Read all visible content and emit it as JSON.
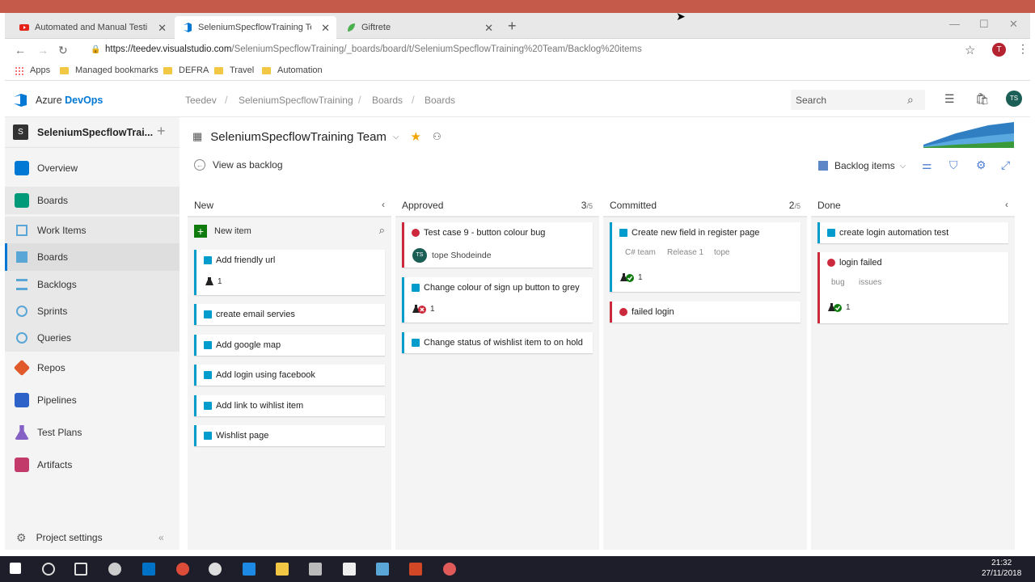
{
  "browser": {
    "tabs": [
      {
        "label": "Automated and Manual Testing",
        "icon": "youtube-icon",
        "color": "#e62117"
      },
      {
        "label": "SeleniumSpecflowTraining Team",
        "icon": "azure-devops-icon",
        "color": "#0078d4"
      },
      {
        "label": "Giftrete",
        "icon": "leaf-icon",
        "color": "#4caf50"
      }
    ],
    "url_host": "https://teedev.visualstudio.com",
    "url_path": "/SeleniumSpecflowTraining/_boards/board/t/SeleniumSpecflowTraining%20Team/Backlog%20items",
    "profile_initial": "T",
    "bookmarks": [
      "Apps",
      "Managed bookmarks",
      "DEFRA",
      "Travel",
      "Automation"
    ]
  },
  "header": {
    "brand_prefix": "Azure ",
    "brand": "DevOps",
    "breadcrumb": [
      "Teedev",
      "SeleniumSpecflowTraining",
      "Boards",
      "Boards"
    ],
    "search_placeholder": "Search",
    "avatar": "TS"
  },
  "sidebar": {
    "project_initial": "S",
    "project_name": "SeleniumSpecflowTrai...",
    "items": [
      {
        "label": "Overview",
        "color": "#0078d4"
      },
      {
        "label": "Boards",
        "color": "#009a78"
      },
      {
        "label": "Work Items",
        "color": "#5aa6d6"
      },
      {
        "label": "Boards",
        "color": "#5aa6d6"
      },
      {
        "label": "Backlogs",
        "color": "#5aa6d6"
      },
      {
        "label": "Sprints",
        "color": "#5aa6d6"
      },
      {
        "label": "Queries",
        "color": "#5aa6d6"
      },
      {
        "label": "Repos",
        "color": "#e05a2b"
      },
      {
        "label": "Pipelines",
        "color": "#2d63c8"
      },
      {
        "label": "Test Plans",
        "color": "#8661c5"
      },
      {
        "label": "Artifacts",
        "color": "#c23a6a"
      }
    ],
    "settings": "Project settings"
  },
  "main": {
    "team_name": "SeleniumSpecflowTraining Team",
    "view_backlog": "View as backlog",
    "backlog_selector": "Backlog items"
  },
  "board": {
    "new_item": "New item",
    "columns": [
      {
        "title": "New"
      },
      {
        "title": "Approved",
        "count": "3",
        "limit": "/5"
      },
      {
        "title": "Committed",
        "count": "2",
        "limit": "/5"
      },
      {
        "title": "Done"
      }
    ],
    "new_cards": [
      {
        "title": "Add friendly url",
        "meta": "1"
      },
      {
        "title": "create email servies"
      },
      {
        "title": "Add google map"
      },
      {
        "title": "Add login using facebook"
      },
      {
        "title": "Add link to wihlist item"
      },
      {
        "title": "Wishlist page"
      }
    ],
    "approved_cards": [
      {
        "title": "Test case 9 -  button colour bug",
        "assignee": "tope Shodeinde",
        "assignee_initials": "TS"
      },
      {
        "title": "Change  colour of sign up button to grey",
        "meta": "1"
      },
      {
        "title": "Change status of wishlist item to on hold"
      }
    ],
    "committed_cards": [
      {
        "title": "Create new field in register page",
        "tags": [
          "C# team",
          "Release 1",
          "tope"
        ],
        "meta": "1"
      },
      {
        "title": "failed login"
      }
    ],
    "done_cards": [
      {
        "title": "create login automation test"
      },
      {
        "title": "login failed",
        "tags": [
          "bug",
          "issues"
        ],
        "meta": "1"
      }
    ]
  },
  "taskbar": {
    "time": "21:32",
    "date": "27/11/2018"
  }
}
